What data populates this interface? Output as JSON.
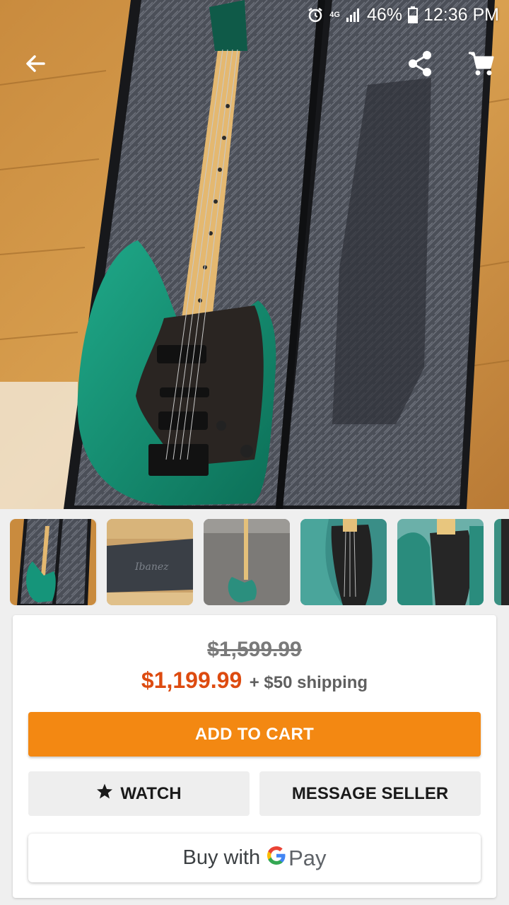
{
  "status_bar": {
    "alarm_icon": "alarm-icon",
    "network_label": "4G",
    "signal_icon": "signal-icon",
    "battery_percent": "46%",
    "battery_icon": "battery-icon",
    "time": "12:36 PM"
  },
  "top_actions": {
    "back_icon": "arrow-left-icon",
    "share_icon": "share-icon",
    "cart_icon": "cart-icon"
  },
  "gallery": {
    "selected_index": 0,
    "thumbnail_count": 6
  },
  "pricing": {
    "original_price": "$1,599.99",
    "price": "$1,199.99",
    "shipping": "+ $50 shipping"
  },
  "actions": {
    "add_to_cart": "ADD TO CART",
    "watch": "WATCH",
    "watch_icon": "star-icon",
    "message_seller": "MESSAGE SELLER",
    "buy_with": "Buy with",
    "gpay_pay": "Pay"
  },
  "colors": {
    "accent_orange": "#f38812",
    "price_red": "#dd4b10",
    "guitar_green": "#138a6d"
  }
}
